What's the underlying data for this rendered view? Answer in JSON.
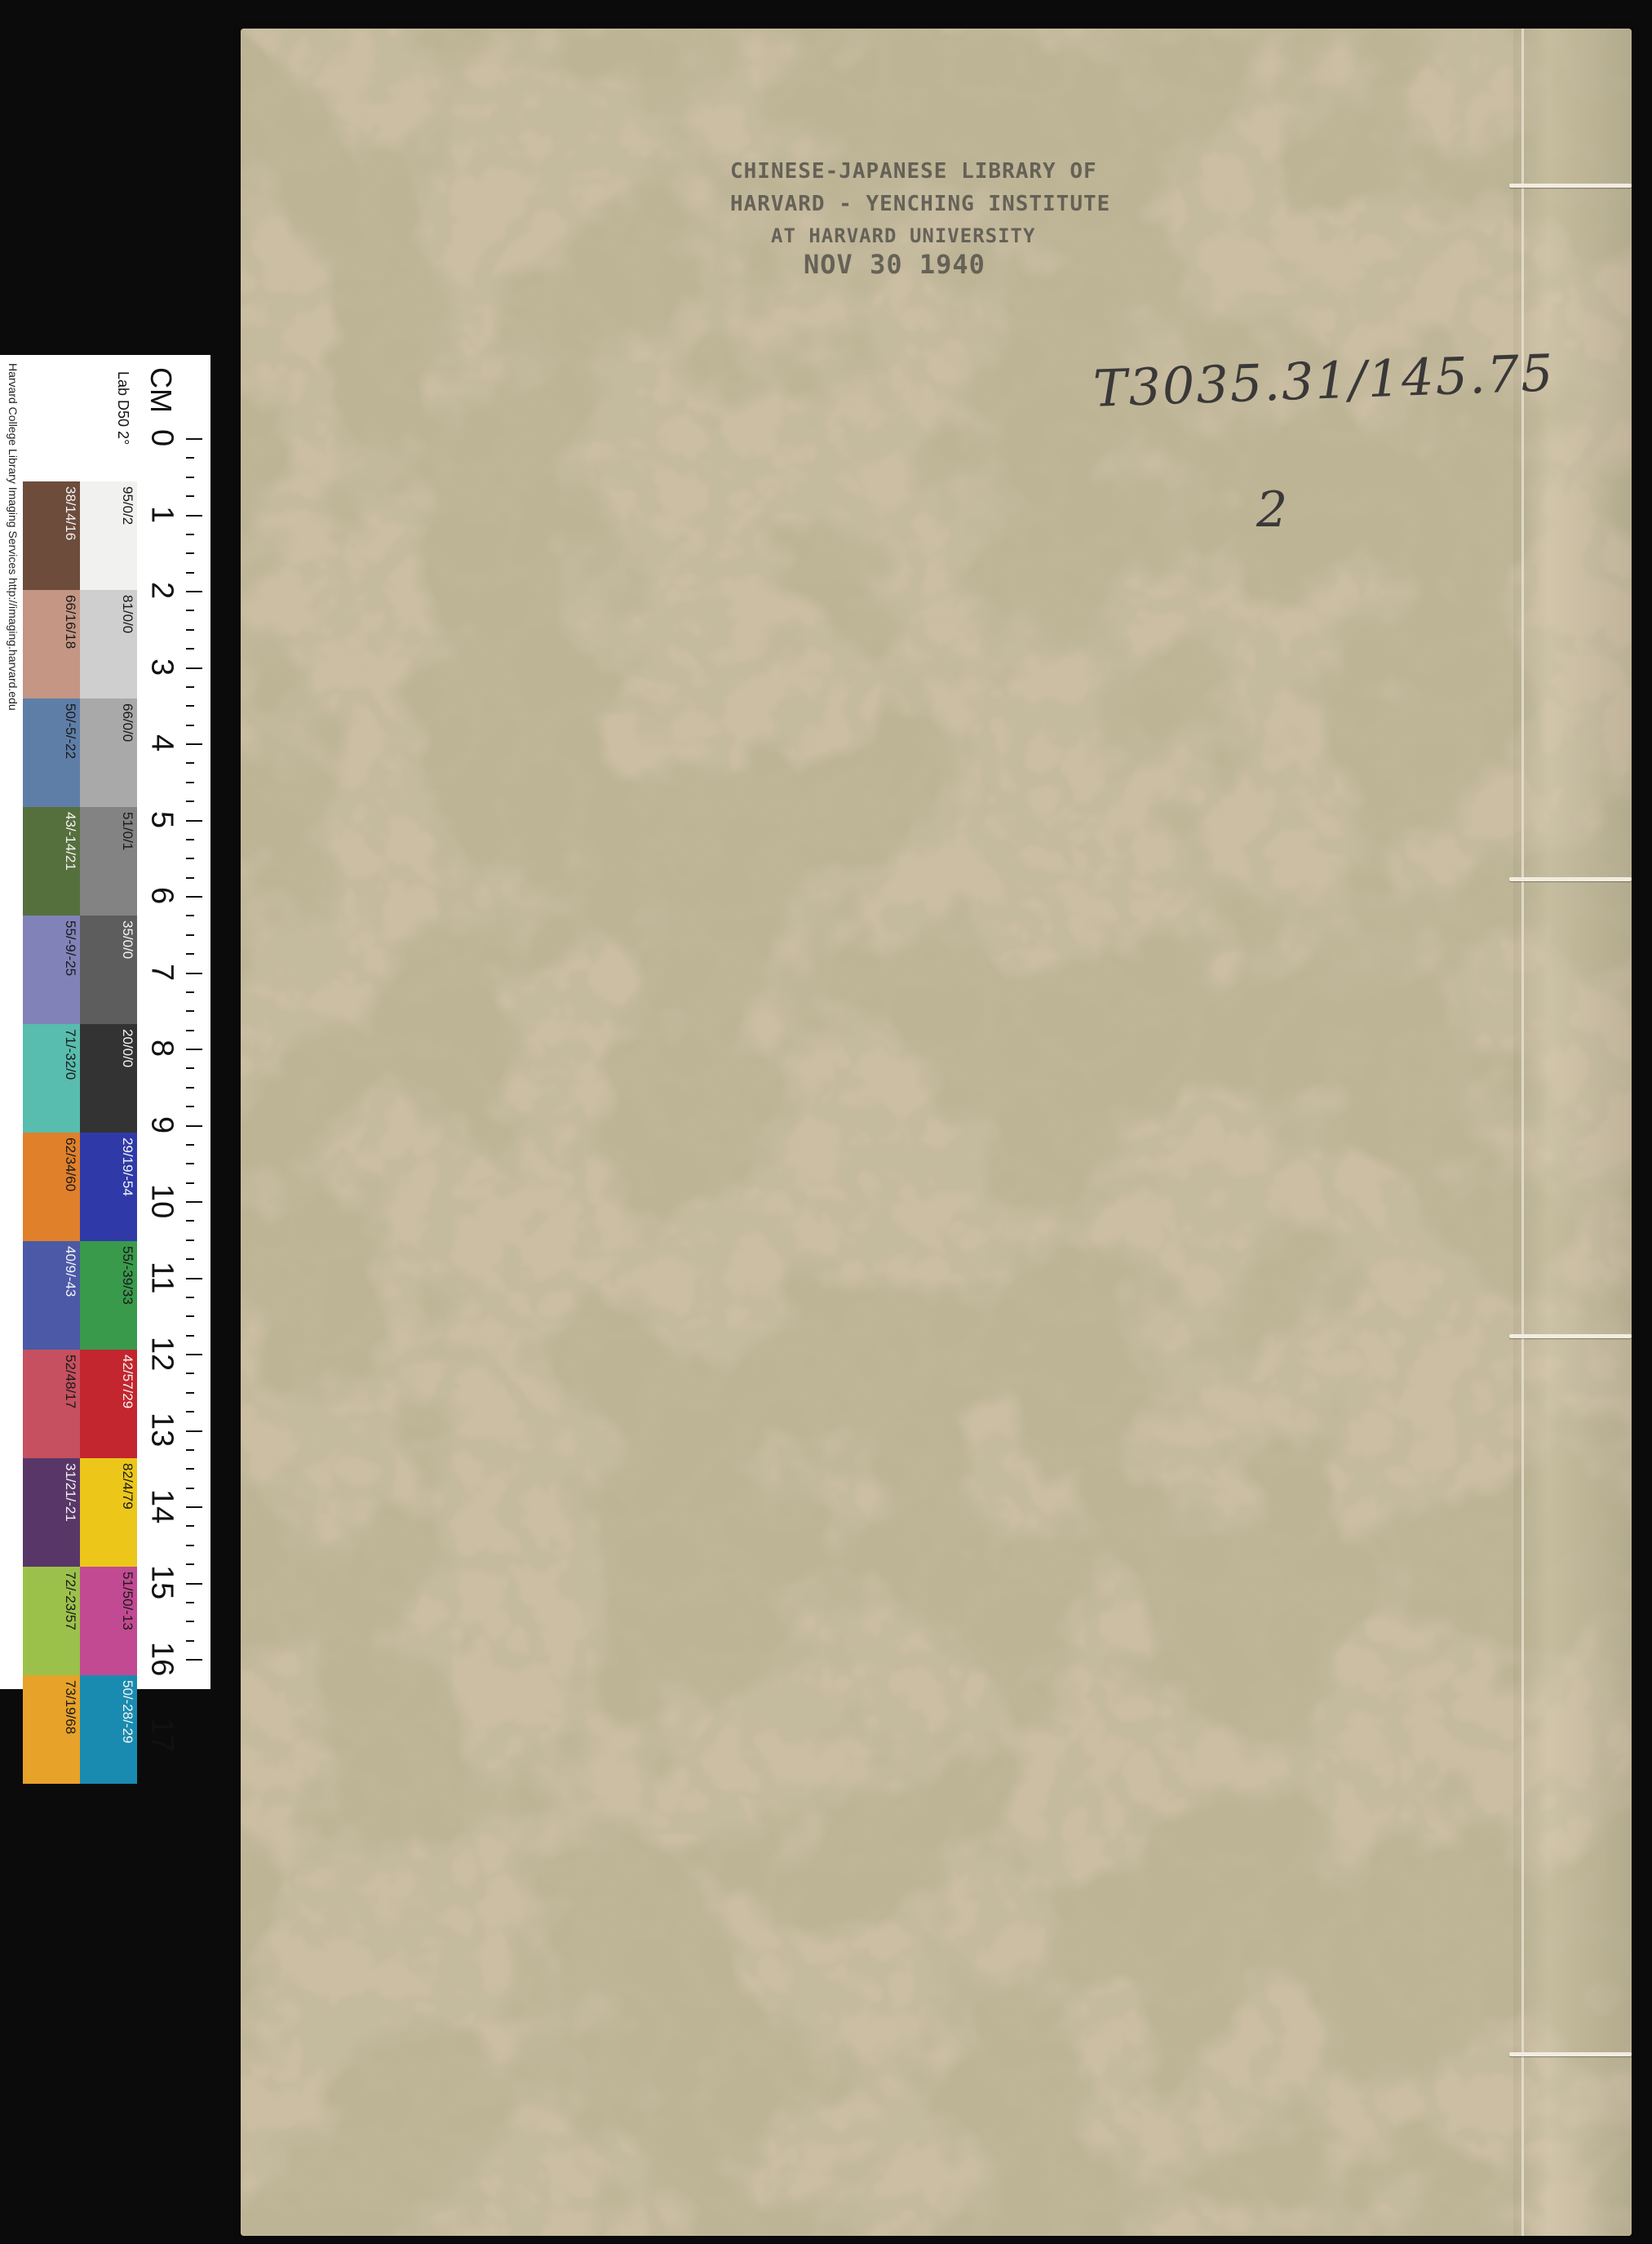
{
  "cover": {
    "stamp_lines": [
      "CHINESE-JAPANESE LIBRARY OF",
      "HARVARD - YENCHING INSTITUTE",
      "AT HARVARD UNIVERSITY",
      "NOV 30 1940"
    ],
    "call_number": "T3035.31/145.75",
    "volume": "2"
  },
  "color_target": {
    "credit": "Harvard College Library Imaging Services http://imaging.harvard.edu",
    "cm_label": "CM",
    "lab_label": "Lab D50 2°",
    "ruler_numbers": [
      "0",
      "1",
      "2",
      "3",
      "4",
      "5",
      "6",
      "7",
      "8",
      "9",
      "10",
      "11",
      "12",
      "13",
      "14",
      "15",
      "16",
      "17"
    ],
    "gray_column": [
      {
        "label": "95/0/2",
        "color": "#f1f1ef"
      },
      {
        "label": "81/0/0",
        "color": "#cfcfcf"
      },
      {
        "label": "66/0/0",
        "color": "#a9a9a9"
      },
      {
        "label": "51/0/1",
        "color": "#838383"
      },
      {
        "label": "35/0/0",
        "color": "#5d5d5d"
      },
      {
        "label": "20/0/0",
        "color": "#333333"
      },
      {
        "label": "29/19/-54",
        "color": "#2f3aa8"
      },
      {
        "label": "55/-39/33",
        "color": "#3a9a4c"
      },
      {
        "label": "42/57/29",
        "color": "#c3262f"
      },
      {
        "label": "82/4/79",
        "color": "#ecc71a"
      },
      {
        "label": "51/50/-13",
        "color": "#c14a92"
      },
      {
        "label": "50/-28/-29",
        "color": "#1a8bb0"
      }
    ],
    "color_column": [
      {
        "label": "38/14/16",
        "color": "#6d4c3c"
      },
      {
        "label": "66/16/18",
        "color": "#c49683"
      },
      {
        "label": "50/-5/-22",
        "color": "#5e7ea8"
      },
      {
        "label": "43/-14/21",
        "color": "#55703d"
      },
      {
        "label": "55/-9/-25",
        "color": "#8183b8"
      },
      {
        "label": "71/-32/0",
        "color": "#58bdae"
      },
      {
        "label": "62/34/60",
        "color": "#e0802a"
      },
      {
        "label": "40/9/-43",
        "color": "#4b59a7"
      },
      {
        "label": "52/48/17",
        "color": "#c6505f"
      },
      {
        "label": "31/21/-21",
        "color": "#593668"
      },
      {
        "label": "72/-23/57",
        "color": "#9cc14b"
      },
      {
        "label": "73/19/68",
        "color": "#e7a229"
      }
    ]
  }
}
